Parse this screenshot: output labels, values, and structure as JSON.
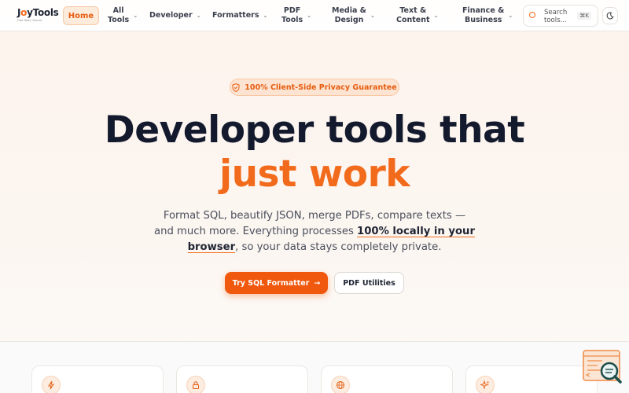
{
  "brand": {
    "name_a": "J",
    "name_o": "o",
    "name_b": "yTools",
    "tagline": "Free Tools. Secure"
  },
  "nav": {
    "home": "Home",
    "items": [
      {
        "line1": "All",
        "line2": "Tools"
      },
      {
        "line1": "Developer",
        "line2": ""
      },
      {
        "line1": "Formatters",
        "line2": ""
      },
      {
        "line1": "PDF",
        "line2": "Tools"
      },
      {
        "line1": "Media &",
        "line2": "Design"
      },
      {
        "line1": "Text &",
        "line2": "Content"
      },
      {
        "line1": "Finance &",
        "line2": "Business"
      }
    ],
    "search_line1": "Search",
    "search_line2": "tools...",
    "search_shortcut": "⌘K"
  },
  "hero": {
    "badge": "100% Client-Side Privacy Guarantee",
    "title_line1": "Developer tools that",
    "title_line2": "just work",
    "sub_part1": "Format SQL, beautify JSON, merge PDFs, compare texts — and much more. Everything processes ",
    "sub_highlight": "100% locally in your browser",
    "sub_part2": ", so your data stays completely private.",
    "cta_primary": "Try SQL Formatter",
    "cta_secondary": "PDF Utilities"
  },
  "cards": [
    {
      "icon": "lightning-icon"
    },
    {
      "icon": "lock-icon"
    },
    {
      "icon": "globe-icon"
    },
    {
      "icon": "sparkle-icon"
    }
  ],
  "colors": {
    "accent": "#f26a1b",
    "dark": "#141a2e"
  }
}
